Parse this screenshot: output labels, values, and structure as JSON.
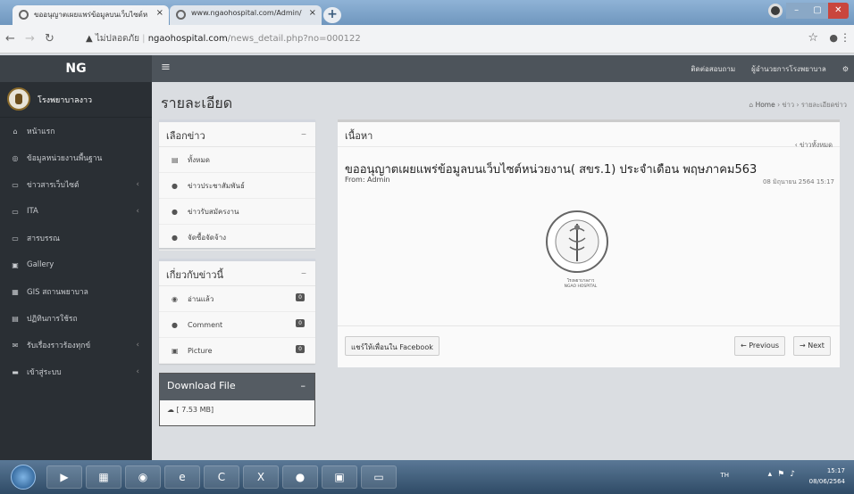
{
  "browser": {
    "tabs": [
      {
        "title": "ขออนุญาตเผยแพร่ข้อมูลบนเว็บไซต์ห"
      },
      {
        "title": "www.ngaohospital.com/Admin/"
      }
    ],
    "newtab": "+",
    "url_warning": "ไม่ปลอดภัย",
    "url_host": "ngaohospital.com",
    "url_path": "/news_detail.php?no=000122"
  },
  "app": {
    "brand": "NG",
    "topnav": [
      "ติดต่อสอบถาม",
      "ผู้อำนวยการโรงพยาบาล"
    ],
    "sidebar_user": "โรงพยาบาลงาว",
    "sidebar_items": [
      {
        "label": "หน้าแรก",
        "icon": "home-icon",
        "glyph": "⌂",
        "submenu": false
      },
      {
        "label": "ข้อมูลหน่วยงานพื้นฐาน",
        "icon": "info-icon",
        "glyph": "◎",
        "submenu": false
      },
      {
        "label": "ข่าวสารเว็บไซต์",
        "icon": "monitor-icon",
        "glyph": "▭",
        "submenu": true
      },
      {
        "label": "ITA",
        "icon": "monitor-icon",
        "glyph": "▭",
        "submenu": true
      },
      {
        "label": "สารบรรณ",
        "icon": "monitor-icon",
        "glyph": "▭",
        "submenu": false
      },
      {
        "label": "Gallery",
        "icon": "image-icon",
        "glyph": "▣",
        "submenu": false
      },
      {
        "label": "GIS สถานพยาบาล",
        "icon": "grid-icon",
        "glyph": "▦",
        "submenu": false
      },
      {
        "label": "ปฏิทินการใช้รถ",
        "icon": "calendar-icon",
        "glyph": "▤",
        "submenu": false
      },
      {
        "label": "รับเรื่องราวร้องทุกข์",
        "icon": "mail-icon",
        "glyph": "✉",
        "submenu": true
      },
      {
        "label": "เข้าสู่ระบบ",
        "icon": "folder-icon",
        "glyph": "▬",
        "submenu": true
      }
    ]
  },
  "page": {
    "title": "รายละเอียด",
    "breadcrumb": {
      "home": "Home",
      "news": "ข่าว",
      "current": "รายละเอียดข่าว"
    }
  },
  "select_news": {
    "header": "เลือกข่าว",
    "items": [
      {
        "label": "ทั้งหมด",
        "icon": "list-icon",
        "glyph": "▤"
      },
      {
        "label": "ข่าวประชาสัมพันธ์",
        "icon": "circle-icon",
        "glyph": "●"
      },
      {
        "label": "ข่าวรับสมัครงาน",
        "icon": "circle-icon",
        "glyph": "●"
      },
      {
        "label": "จัดซื้อจัดจ้าง",
        "icon": "circle-icon",
        "glyph": "●"
      }
    ]
  },
  "about_news": {
    "header": "เกี่ยวกับข่าวนี้",
    "items": [
      {
        "label": "อ่านแล้ว",
        "icon": "eye-icon",
        "glyph": "◉",
        "count": "0"
      },
      {
        "label": "Comment",
        "icon": "comment-icon",
        "glyph": "●",
        "count": "0"
      },
      {
        "label": "Picture",
        "icon": "picture-icon",
        "glyph": "▣",
        "count": "0"
      }
    ]
  },
  "download": {
    "header": "Download File",
    "file": "[ 7.53 MB]"
  },
  "content": {
    "header": "เนื้อหา",
    "all_news": "ข่าวทั้งหมด",
    "news_title": "ขออนุญาตเผยแพร่ข้อมูลบนเว็บไซต์หน่วยงาน( สขร.1) ประจำเดือน พฤษภาคม563",
    "from": "From: Admin",
    "date": "08 มิถุนายน 2564 15:17",
    "seal_caption_1": "โรงพยาบาลงาว",
    "seal_caption_2": "NGAO HOSPITAL",
    "share": "แชร์ให้เพื่อนใน Facebook",
    "prev": "Previous",
    "next": "Next"
  },
  "taskbar": {
    "lang": "TH",
    "time": "15:17",
    "date": "08/06/2564"
  }
}
